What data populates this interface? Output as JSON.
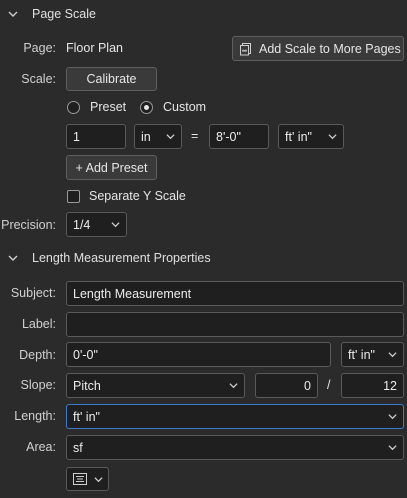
{
  "page_scale": {
    "header": "Page Scale",
    "page_label": "Page:",
    "page_value": "Floor Plan",
    "add_scale_button": "Add Scale to More Pages",
    "scale_label": "Scale:",
    "calibrate_button": "Calibrate",
    "preset_label": "Preset",
    "custom_label": "Custom",
    "scale_value": "1",
    "scale_unit": "in",
    "equals": "=",
    "real_value": "8'-0\"",
    "real_unit": "ft' in\"",
    "add_preset_button": "+ Add Preset",
    "separate_y_label": "Separate Y Scale",
    "precision_label": "Precision:",
    "precision_value": "1/4"
  },
  "length_props": {
    "header": "Length Measurement Properties",
    "subject_label": "Subject:",
    "subject_value": "Length Measurement",
    "label_label": "Label:",
    "label_value": "",
    "depth_label": "Depth:",
    "depth_value": "0'-0\"",
    "depth_unit": "ft' in\"",
    "slope_label": "Slope:",
    "slope_type": "Pitch",
    "slope_rise": "0",
    "slope_sep": "/",
    "slope_run": "12",
    "length_label": "Length:",
    "length_unit": "ft' in\"",
    "area_label": "Area:",
    "area_unit": "sf"
  },
  "icons": {
    "chevron": "chevron-down-icon",
    "add_scale": "pages-scale-icon",
    "format": "text-align-icon"
  }
}
